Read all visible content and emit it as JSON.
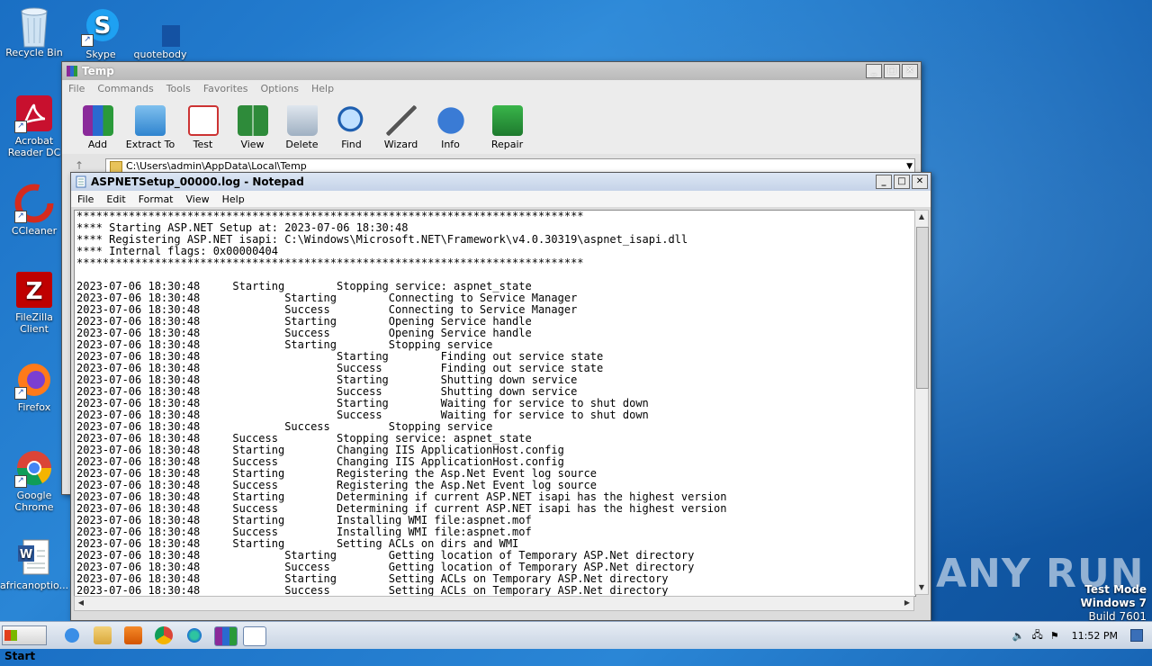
{
  "desktop_icons": [
    {
      "label": "Recycle Bin",
      "icon": "recycle-bin-icon"
    },
    {
      "label": "Skype",
      "icon": "skype-icon"
    },
    {
      "label": "quotebody",
      "icon": "file-icon"
    },
    {
      "label": "Acrobat Reader DC",
      "icon": "acrobat-icon"
    },
    {
      "label": "CCleaner",
      "icon": "ccleaner-icon"
    },
    {
      "label": "FileZilla Client",
      "icon": "filezilla-icon"
    },
    {
      "label": "Firefox",
      "icon": "firefox-icon"
    },
    {
      "label": "Google Chrome",
      "icon": "chrome-icon"
    },
    {
      "label": "africanoptio...",
      "icon": "word-doc-icon"
    }
  ],
  "winrar": {
    "title": "Temp",
    "menu": [
      "File",
      "Commands",
      "Tools",
      "Favorites",
      "Options",
      "Help"
    ],
    "toolbar": [
      "Add",
      "Extract To",
      "Test",
      "View",
      "Delete",
      "Find",
      "Wizard",
      "Info",
      "Repair"
    ],
    "path": "C:\\Users\\admin\\AppData\\Local\\Temp"
  },
  "notepad": {
    "title": "ASPNETSetup_00000.log - Notepad",
    "menu": [
      "File",
      "Edit",
      "Format",
      "View",
      "Help"
    ],
    "text": "******************************************************************************\n**** Starting ASP.NET Setup at: 2023-07-06 18:30:48\n**** Registering ASP.NET isapi: C:\\Windows\\Microsoft.NET\\Framework\\v4.0.30319\\aspnet_isapi.dll\n**** Internal flags: 0x00000404\n******************************************************************************\n\n2023-07-06 18:30:48\tStarting\tStopping service: aspnet_state\n2023-07-06 18:30:48\t\tStarting\tConnecting to Service Manager\n2023-07-06 18:30:48\t\tSuccess \tConnecting to Service Manager\n2023-07-06 18:30:48\t\tStarting\tOpening Service handle\n2023-07-06 18:30:48\t\tSuccess \tOpening Service handle\n2023-07-06 18:30:48\t\tStarting\tStopping service\n2023-07-06 18:30:48\t\t\tStarting\tFinding out service state\n2023-07-06 18:30:48\t\t\tSuccess \tFinding out service state\n2023-07-06 18:30:48\t\t\tStarting\tShutting down service\n2023-07-06 18:30:48\t\t\tSuccess \tShutting down service\n2023-07-06 18:30:48\t\t\tStarting\tWaiting for service to shut down\n2023-07-06 18:30:48\t\t\tSuccess \tWaiting for service to shut down\n2023-07-06 18:30:48\t\tSuccess \tStopping service\n2023-07-06 18:30:48\tSuccess \tStopping service: aspnet_state\n2023-07-06 18:30:48\tStarting\tChanging IIS ApplicationHost.config\n2023-07-06 18:30:48\tSuccess \tChanging IIS ApplicationHost.config\n2023-07-06 18:30:48\tStarting\tRegistering the Asp.Net Event log source\n2023-07-06 18:30:48\tSuccess \tRegistering the Asp.Net Event log source\n2023-07-06 18:30:48\tStarting\tDetermining if current ASP.NET isapi has the highest version\n2023-07-06 18:30:48\tSuccess \tDetermining if current ASP.NET isapi has the highest version\n2023-07-06 18:30:48\tStarting\tInstalling WMI file:aspnet.mof\n2023-07-06 18:30:48\tSuccess \tInstalling WMI file:aspnet.mof\n2023-07-06 18:30:48\tStarting\tSetting ACLs on dirs and WMI\n2023-07-06 18:30:48\t\tStarting\tGetting location of Temporary ASP.Net directory\n2023-07-06 18:30:48\t\tSuccess \tGetting location of Temporary ASP.Net directory\n2023-07-06 18:30:48\t\tStarting\tSetting ACLs on Temporary ASP.Net directory\n2023-07-06 18:30:48\t\tSuccess \tSetting ACLs on Temporary ASP.Net directory"
  },
  "taskbar": {
    "start_label": "Start",
    "clock": "11:52 PM",
    "pinned": [
      "ie-icon",
      "explorer-icon",
      "media-player-icon",
      "chrome-icon",
      "edge-icon",
      "winrar-icon",
      "notepad-icon"
    ]
  },
  "watermark": {
    "logo": "ANY RUN",
    "line1": "Test Mode",
    "line2": "Windows 7",
    "line3": "Build 7601"
  }
}
